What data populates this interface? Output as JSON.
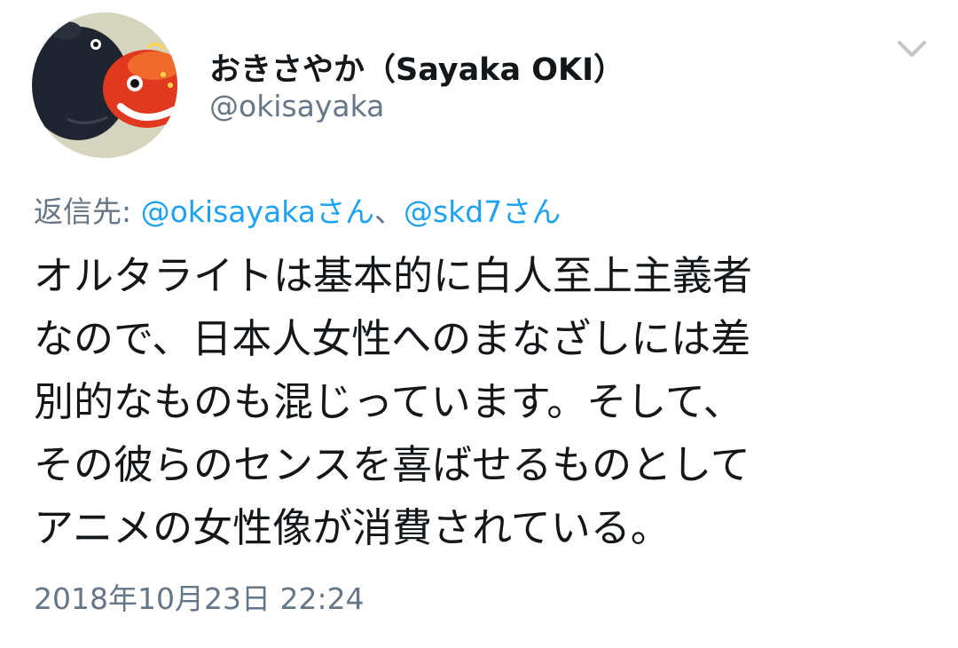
{
  "author": {
    "display_name": "おきさやか（Sayaka OKI）",
    "handle": "@okisayaka",
    "avatar_icon": "plush-toys-avatar"
  },
  "menu": {
    "icon": "chevron-down-icon",
    "color": "#c0c6cc"
  },
  "reply": {
    "prefix": "返信先: ",
    "mention1": "@okisayakaさん",
    "separator": "、",
    "mention2": "@skd7さん"
  },
  "tweet": {
    "lines": [
      "オルタライトは基本的に白人至上主義者",
      "なので、日本人女性へのまなざしには差",
      "別的なものも混じっています。そして、",
      "その彼らのセンスを喜ばせるものとして",
      "アニメの女性像が消費されている。"
    ]
  },
  "timestamp": "2018年10月23日 22:24",
  "colors": {
    "text": "#14171a",
    "secondary": "#657786",
    "link": "#1da1f2"
  }
}
